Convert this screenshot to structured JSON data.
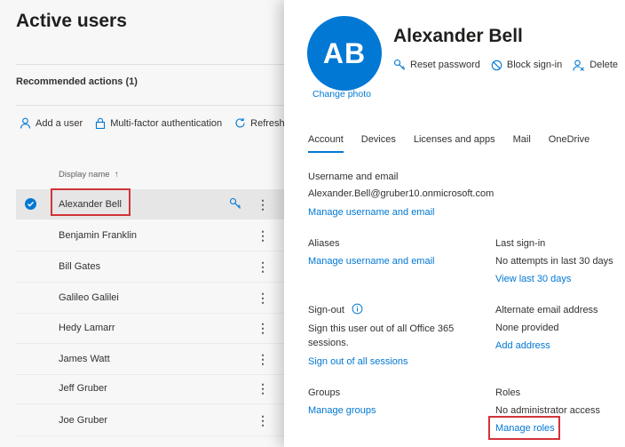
{
  "page": {
    "title": "Active users",
    "recommended_actions": "Recommended actions (1)",
    "toolbar": {
      "add_user": "Add a user",
      "mfa": "Multi-factor authentication",
      "refresh": "Refresh"
    },
    "column_header": "Display name",
    "sort_arrow": "↑",
    "users": [
      "Alexander Bell",
      "Benjamin Franklin",
      "Bill Gates",
      "Galileo Galilei",
      "Hedy Lamarr",
      "James Watt",
      "Jeff Gruber",
      "Joe Gruber"
    ],
    "more_glyph": "⋮"
  },
  "panel": {
    "avatar_initials": "AB",
    "change_photo": "Change photo",
    "user_name": "Alexander Bell",
    "actions": {
      "reset_password": "Reset password",
      "block_signin": "Block sign-in",
      "delete": "Delete"
    },
    "tabs": [
      "Account",
      "Devices",
      "Licenses and apps",
      "Mail",
      "OneDrive"
    ],
    "active_tab": "Account",
    "username_email": {
      "label": "Username and email",
      "value": "Alexander.Bell@gruber10.onmicrosoft.com",
      "link": "Manage username and email"
    },
    "aliases": {
      "label": "Aliases",
      "link": "Manage username and email"
    },
    "last_signin": {
      "label": "Last sign-in",
      "value": "No attempts in last 30 days",
      "link": "View last 30 days"
    },
    "signout": {
      "label": "Sign-out",
      "value_line1": "Sign this user out of all Office 365",
      "value_line2": "sessions.",
      "link": "Sign out of all sessions"
    },
    "alt_email": {
      "label": "Alternate email address",
      "value": "None provided",
      "link": "Add address"
    },
    "groups": {
      "label": "Groups",
      "link": "Manage groups"
    },
    "roles": {
      "label": "Roles",
      "value": "No administrator access",
      "link": "Manage roles"
    }
  },
  "colors": {
    "accent": "#0078d4",
    "highlight_box": "#d13438"
  }
}
